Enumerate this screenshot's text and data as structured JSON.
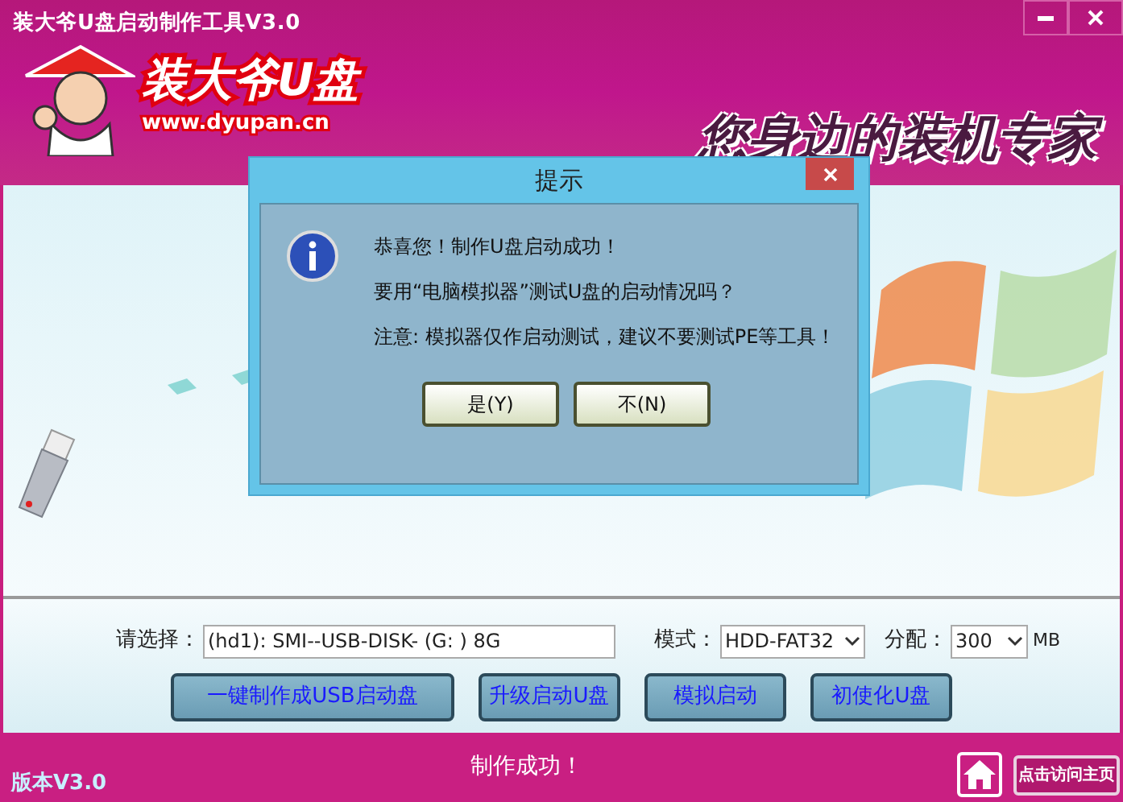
{
  "window": {
    "title": "装大爷U盘启动制作工具V3.0"
  },
  "logo": {
    "name": "装大爷U盘",
    "url": "www.dyupan.cn"
  },
  "slogan": "您身边的装机专家",
  "form": {
    "select_label": "请选择：",
    "device": "(hd1): SMI--USB-DISK- (G: ) 8G",
    "mode_label": "模式：",
    "mode": "HDD-FAT32",
    "alloc_label": "分配：",
    "alloc": "300",
    "alloc_unit": "MB"
  },
  "actions": [
    "一键制作成USB启动盘",
    "升级启动U盘",
    "模拟启动",
    "初使化U盘"
  ],
  "status_bar": {
    "version": "版本V3.0",
    "message": "制作成功！",
    "homepage_button": "点击访问主页"
  },
  "dialog": {
    "title": "提示",
    "lines": [
      "恭喜您！制作U盘启动成功！",
      "要用“电脑模拟器”测试U盘的启动情况吗？",
      "注意: 模拟器仅作启动测试，建议不要测试PE等工具！"
    ],
    "buttons": [
      "是(Y)",
      "不(N)"
    ]
  }
}
